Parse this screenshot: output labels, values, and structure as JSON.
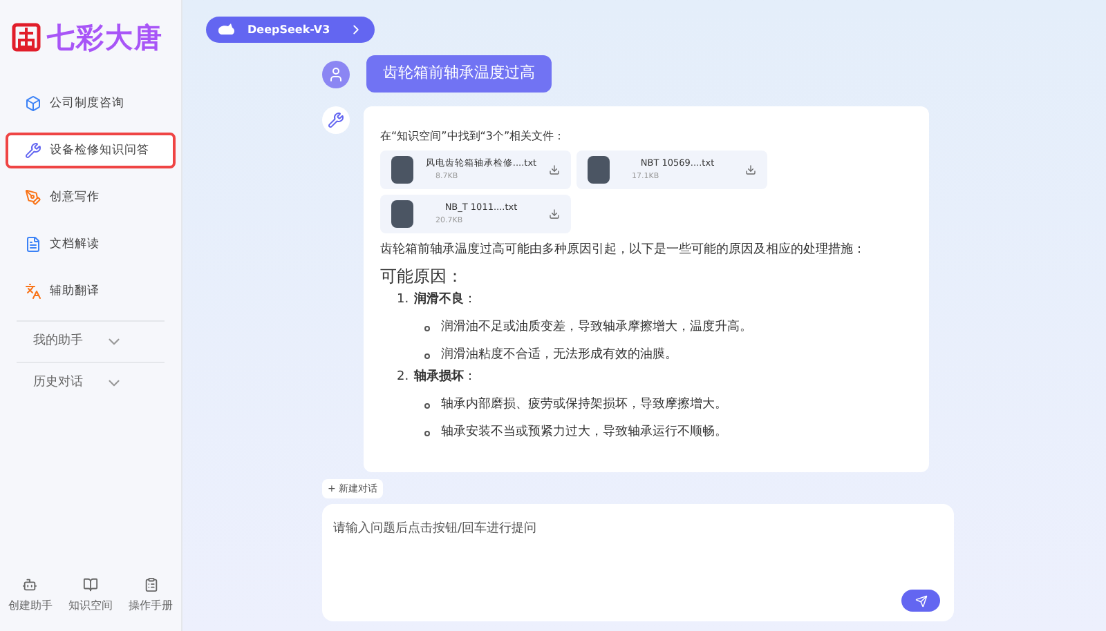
{
  "sidebar": {
    "logo_text": "七彩大唐",
    "items": [
      {
        "label": "公司制度咨询",
        "selected": false
      },
      {
        "label": "设备检修知识问答",
        "selected": true
      },
      {
        "label": "创意写作",
        "selected": false
      },
      {
        "label": "文档解读",
        "selected": false
      },
      {
        "label": "辅助翻译",
        "selected": false
      }
    ],
    "sections": [
      {
        "label": "我的助手",
        "expanded": false
      },
      {
        "label": "历史对话",
        "expanded": false
      }
    ],
    "footer": [
      {
        "label": "创建助手"
      },
      {
        "label": "知识空间"
      },
      {
        "label": "操作手册"
      }
    ]
  },
  "model_selector": {
    "label": "DeepSeek-V3"
  },
  "user_message": "齿轮箱前轴承温度过高",
  "answer": {
    "found_text": "在“知识空间”中找到“3个”相关文件：",
    "files": [
      {
        "name": "风电齿轮箱轴承检修....txt",
        "size": "8.7KB"
      },
      {
        "name": "NBT 10569....txt",
        "size": "17.1KB"
      },
      {
        "name": "NB_T 1011....txt",
        "size": "20.7KB"
      }
    ],
    "intro": "齿轮箱前轴承温度过高可能由多种原因引起，以下是一些可能的原因及相应的处理措施：",
    "heading": "可能原因：",
    "causes": [
      {
        "number": "1.",
        "title": "**润滑不良**：",
        "bullets": [
          "润滑油不足或油质变差，导致轴承摩擦增大，温度升高。",
          "润滑油粘度不合适，无法形成有效的油膜。"
        ]
      },
      {
        "number": "2.",
        "title": "**轴承损坏**：",
        "bullets": [
          "轴承内部磨损、疲劳或保持架损坏，导致摩擦增大。",
          "轴承安装不当或预紧力过大，导致轴承运行不顺畅。"
        ]
      }
    ]
  },
  "new_chat": "+ 新建对话",
  "input": {
    "placeholder": "请输入问题后点击按钮/回车进行提问"
  }
}
